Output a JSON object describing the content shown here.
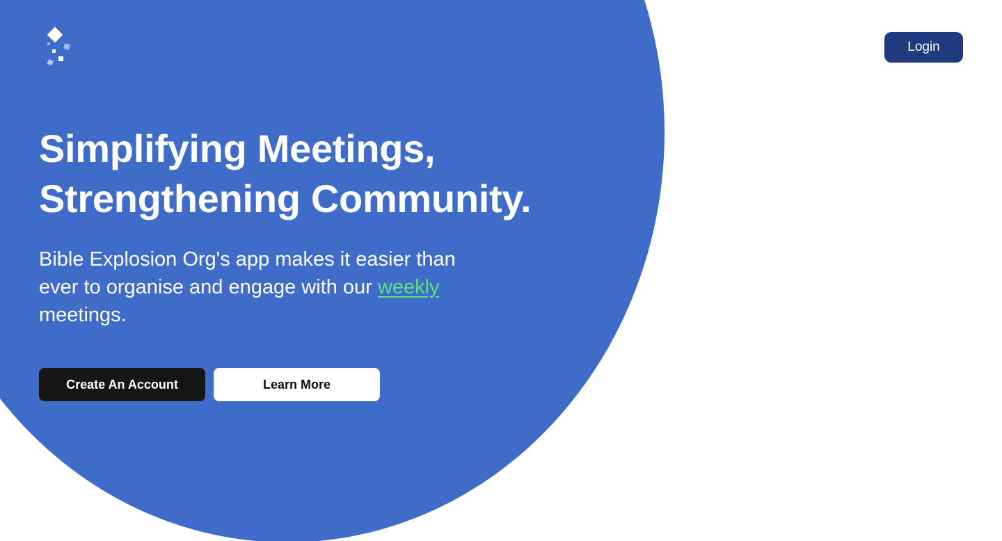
{
  "header": {
    "logo_icon": "sparkle-diamond-logo",
    "login_label": "Login"
  },
  "hero": {
    "headline_line1": "Simplifying Meetings,",
    "headline_line2": "Strengthening Community.",
    "subtext_before_link": "Bible Explosion Org's app makes it easier than ever to organise and engage with our ",
    "subtext_link": "weekly",
    "subtext_after_link": " meetings.",
    "primary_button_label": "Create An Account",
    "secondary_button_label": "Learn More"
  },
  "colors": {
    "hero_background": "#3e6cc8",
    "login_button": "#203a80",
    "link_accent": "#5fe07d",
    "primary_button": "#151515"
  }
}
